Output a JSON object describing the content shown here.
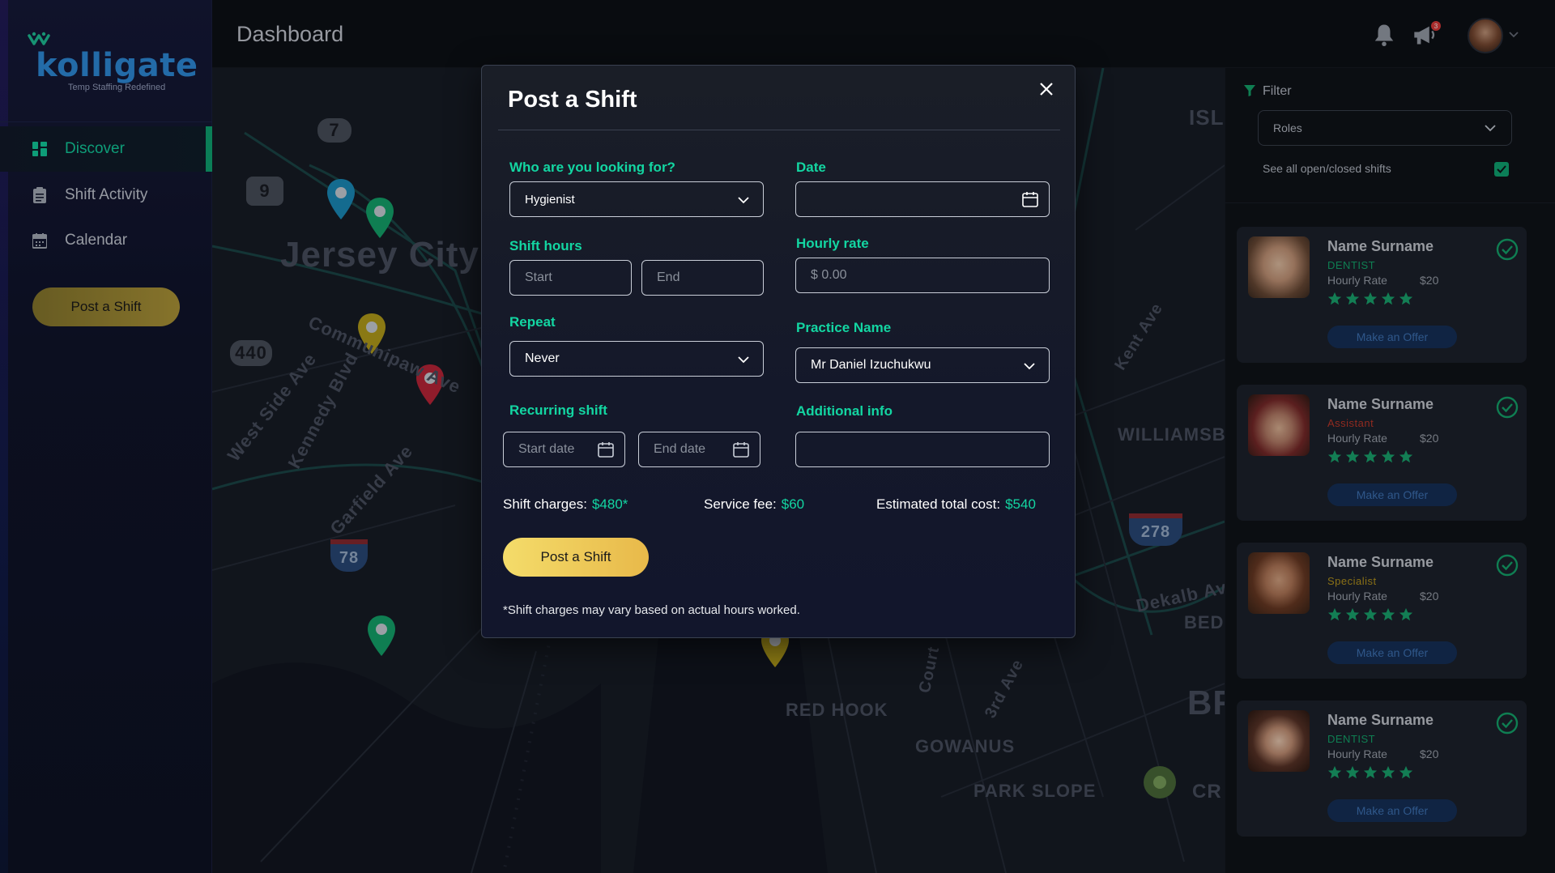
{
  "app": {
    "brand": "kolligate",
    "tagline": "Temp Staffing Redefined"
  },
  "header": {
    "title": "Dashboard",
    "notification_count": "3"
  },
  "sidebar": {
    "items": [
      {
        "label": "Discover",
        "icon": "grid-icon",
        "active": true
      },
      {
        "label": "Shift Activity",
        "icon": "clipboard-icon",
        "active": false
      },
      {
        "label": "Calendar",
        "icon": "calendar-icon",
        "active": false
      }
    ],
    "cta_label": "Post a Shift"
  },
  "map": {
    "labels": [
      "Jersey City",
      "Communipaw Ave",
      "West Side Ave",
      "Kennedy Blvd",
      "Garfield Ave",
      "RED HOOK",
      "GOWANUS",
      "PARK SLOPE",
      "WILLIAMSB",
      "Dekalb Av",
      "BED",
      "CR",
      "ISL",
      "Kent Ave",
      "3rd Ave",
      "Court",
      "BR"
    ],
    "shields": [
      "7",
      "9",
      "440",
      "78",
      "278"
    ]
  },
  "filter": {
    "title": "Filter",
    "roles_placeholder": "Roles",
    "see_all_label": "See all open/closed shifts",
    "see_all_checked": true
  },
  "candidates": [
    {
      "name": "Name Surname",
      "role": "DENTIST",
      "role_color": "#14a86e",
      "rate_label": "Hourly Rate",
      "rate": "$20",
      "stars": 5,
      "button": "Make an Offer"
    },
    {
      "name": "Name Surname",
      "role": "Assistant",
      "role_color": "#c0392b",
      "rate_label": "Hourly Rate",
      "rate": "$20",
      "stars": 5,
      "button": "Make an Offer"
    },
    {
      "name": "Name Surname",
      "role": "Specialist",
      "role_color": "#b8961e",
      "rate_label": "Hourly Rate",
      "rate": "$20",
      "stars": 5,
      "button": "Make an Offer"
    },
    {
      "name": "Name Surname",
      "role": "DENTIST",
      "role_color": "#14a86e",
      "rate_label": "Hourly Rate",
      "rate": "$20",
      "stars": 5,
      "button": "Make an Offer"
    }
  ],
  "modal": {
    "title": "Post a Shift",
    "who_label": "Who are you looking for?",
    "who_value": "Hygienist",
    "date_label": "Date",
    "date_value": "",
    "shift_hours_label": "Shift hours",
    "start_placeholder": "Start",
    "end_placeholder": "End",
    "hourly_rate_label": "Hourly rate",
    "hourly_rate_placeholder": "$ 0.00",
    "repeat_label": "Repeat",
    "repeat_value": "Never",
    "practice_label": "Practice Name",
    "practice_value": "Mr Daniel Izuchukwu",
    "recurring_label": "Recurring shift",
    "start_date_placeholder": "Start date",
    "end_date_placeholder": "End date",
    "additional_label": "Additional info",
    "additional_value": "",
    "shift_charges_label": "Shift charges:",
    "shift_charges_value": "$480*",
    "service_fee_label": "Service fee:",
    "service_fee_value": "$60",
    "total_label": "Estimated total cost:",
    "total_value": "$540",
    "submit_label": "Post a Shift",
    "note": "*Shift charges may vary based on actual hours worked."
  },
  "colors": {
    "accent": "#13d6a2",
    "brand": "#2f8fe0",
    "button": "#f4dc6a"
  }
}
